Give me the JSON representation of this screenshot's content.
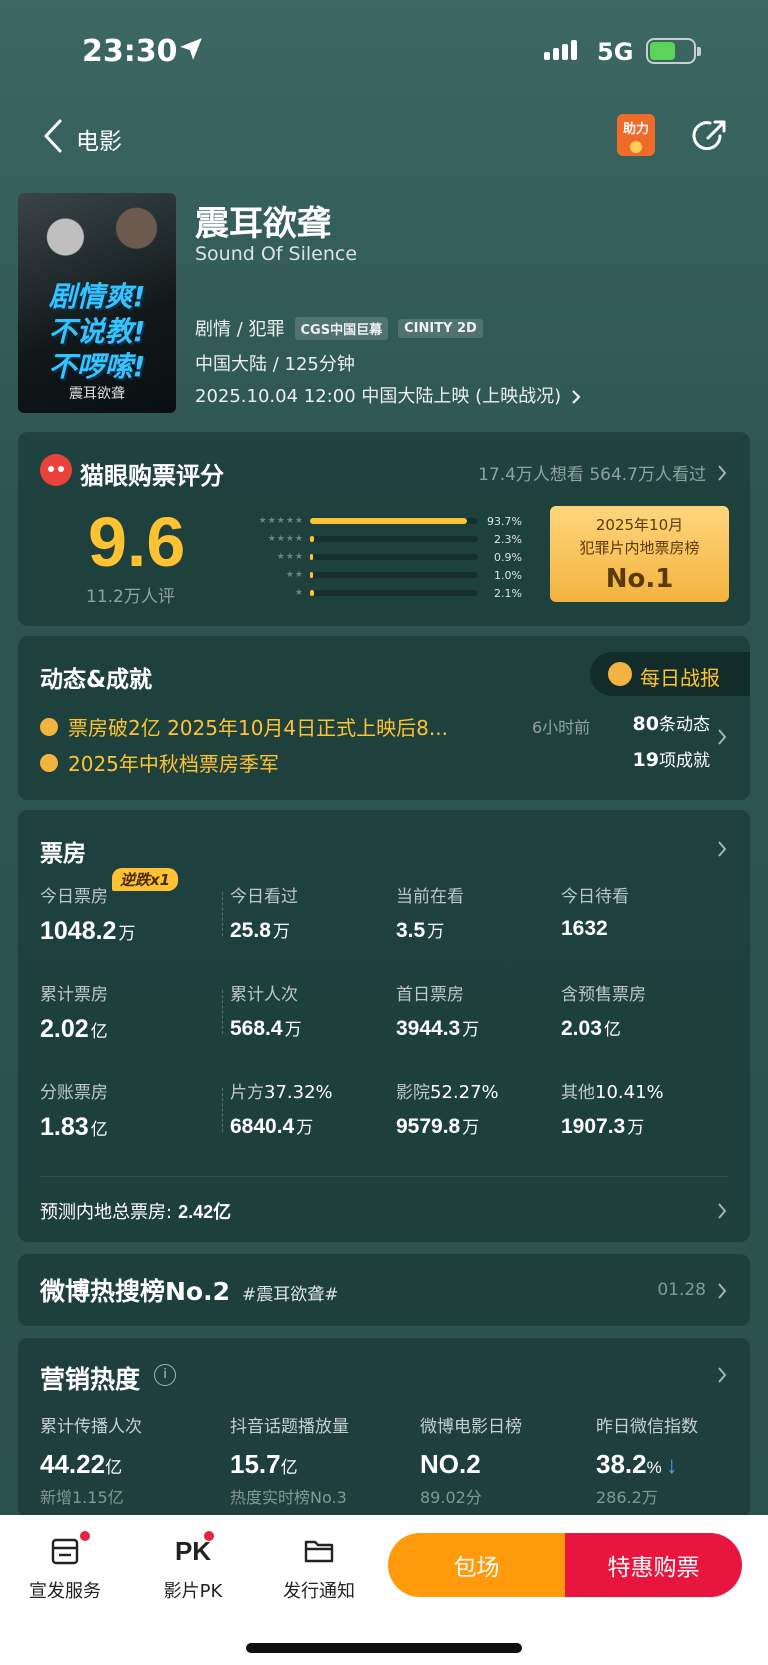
{
  "status_bar": {
    "time": "23:30",
    "network": "5G",
    "battery_level": 0.6
  },
  "nav": {
    "back_label": "电影",
    "help_label": "助力"
  },
  "movie": {
    "title": "震耳欲聋",
    "english_title": "Sound Of Silence",
    "poster_slogan": [
      "剧情爽!",
      "不说教!",
      "不啰嗦!"
    ],
    "poster_title": "震耳欲聋",
    "genre": "剧情 / 犯罪",
    "tags": [
      "CGS中国巨幕",
      "CINITY 2D"
    ],
    "region_duration": "中国大陆 / 125分钟",
    "release": "2025.10.04 12:00 中国大陆上映 (上映战况)"
  },
  "rating": {
    "title": "猫眼购票评分",
    "stats": "17.4万人想看 564.7万人看过",
    "score": "9.6",
    "count": "11.2万人评",
    "distribution": [
      {
        "stars": "★★★★★",
        "pct_label": "93.7%",
        "pct": 93.7
      },
      {
        "stars": "★★★★",
        "pct_label": "2.3%",
        "pct": 2.3
      },
      {
        "stars": "★★★",
        "pct_label": "0.9%",
        "pct": 0.9
      },
      {
        "stars": "★★",
        "pct_label": "1.0%",
        "pct": 1.0
      },
      {
        "stars": "★",
        "pct_label": "2.1%",
        "pct": 2.1
      }
    ],
    "rank": {
      "line1": "2025年10月",
      "line2": "犯罪片内地票房榜",
      "line3": "No.1"
    }
  },
  "dynamics": {
    "title": "动态&成就",
    "daily_label": "每日战报",
    "news": "票房破2亿 2025年10月4日正式上映后8...",
    "news_ago": "6小时前",
    "achievement": "2025年中秋档票房季军",
    "dyn_count": "80",
    "dyn_suffix": "条动态",
    "ach_count": "19",
    "ach_suffix": "项成就"
  },
  "box_office": {
    "title": "票房",
    "reverse_tag": "逆跌x1",
    "rows": [
      [
        {
          "label": "今日票房",
          "value": "1048.2",
          "unit": "万"
        },
        {
          "label": "今日看过",
          "value": "25.8",
          "unit": "万"
        },
        {
          "label": "当前在看",
          "value": "3.5",
          "unit": "万"
        },
        {
          "label": "今日待看",
          "value": "1632",
          "unit": ""
        }
      ],
      [
        {
          "label": "累计票房",
          "value": "2.02",
          "unit": "亿"
        },
        {
          "label": "累计人次",
          "value": "568.4",
          "unit": "万"
        },
        {
          "label": "首日票房",
          "value": "3944.3",
          "unit": "万"
        },
        {
          "label": "含预售票房",
          "value": "2.03",
          "unit": "亿"
        }
      ],
      [
        {
          "label": "分账票房",
          "value": "1.83",
          "unit": "亿"
        },
        {
          "label": "片方",
          "pct": "37.32%",
          "value": "6840.4",
          "unit": "万"
        },
        {
          "label": "影院",
          "pct": "52.27%",
          "value": "9579.8",
          "unit": "万"
        },
        {
          "label": "其他",
          "pct": "10.41%",
          "value": "1907.3",
          "unit": "万"
        }
      ]
    ],
    "predict_label": "预测内地总票房:",
    "predict_value": "2.42亿"
  },
  "weibo": {
    "title": "微博热搜榜No.2",
    "tag": "#震耳欲聋#",
    "time": "01.28"
  },
  "marketing": {
    "title": "营销热度",
    "info": "i",
    "items": [
      {
        "label": "累计传播人次",
        "value": "44.22",
        "unit": "亿",
        "sub": "新增1.15亿"
      },
      {
        "label": "抖音话题播放量",
        "value": "15.7",
        "unit": "亿",
        "sub": "热度实时榜No.3"
      },
      {
        "label": "微博电影日榜",
        "value": "NO.2",
        "unit": "",
        "sub": "89.02分"
      },
      {
        "label": "昨日微信指数",
        "value": "38.2",
        "unit": "%",
        "arrow": "↓",
        "sub": "286.2万"
      }
    ]
  },
  "bottom_bar": {
    "items": [
      {
        "label": "宣发服务",
        "icon": "PR"
      },
      {
        "label": "影片PK",
        "icon": "PK"
      },
      {
        "label": "发行通知",
        "icon": "folder"
      }
    ],
    "book_label": "包场",
    "buy_label": "特惠购票"
  },
  "colors": {
    "accent": "#ffc233",
    "orange": "#ff9b0a",
    "red": "#e8163e",
    "bg": "#2f5753"
  }
}
